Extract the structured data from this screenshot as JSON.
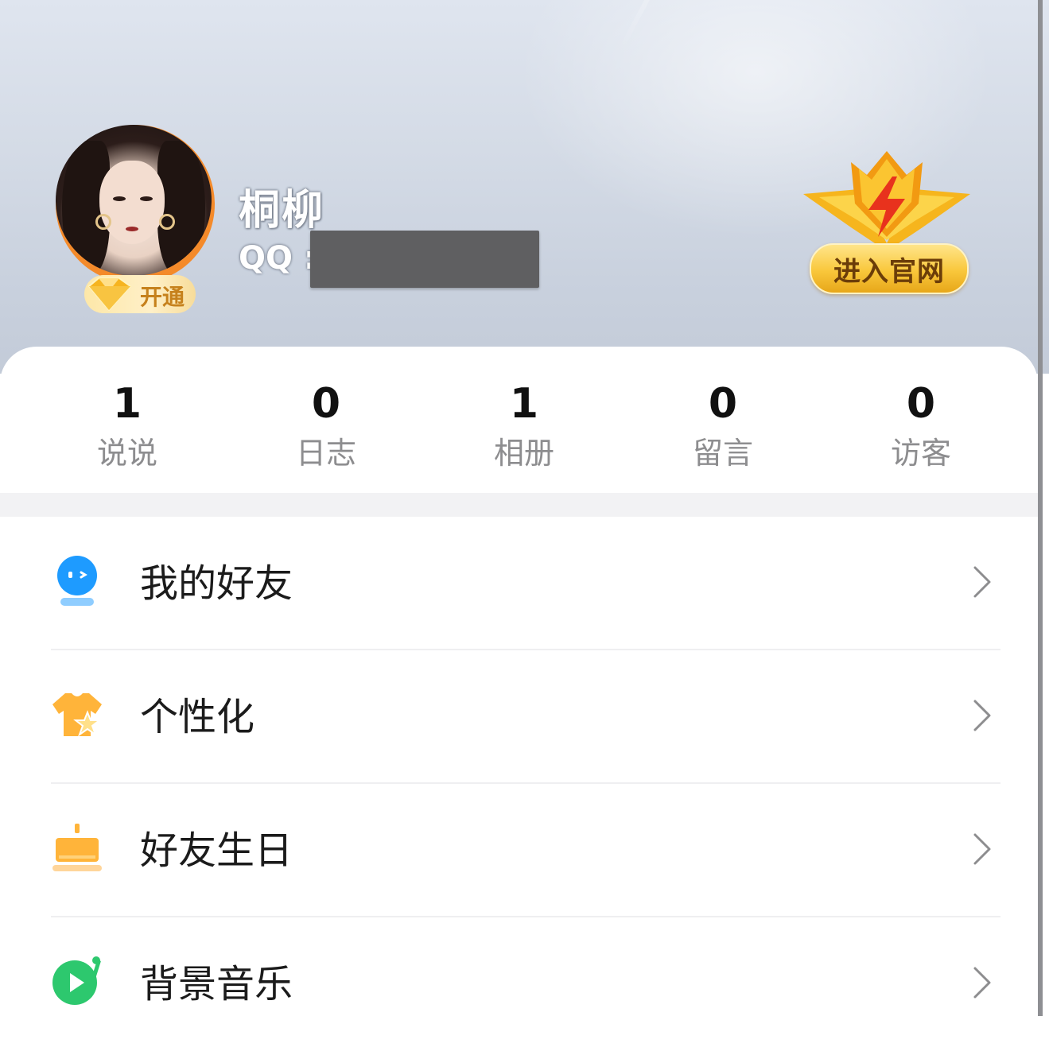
{
  "profile": {
    "name": "桐柳",
    "qq_label": "QQ :",
    "vip_badge_label": "开通",
    "official_button_label": "进入官网"
  },
  "stats": [
    {
      "value": "1",
      "label": "说说"
    },
    {
      "value": "0",
      "label": "日志"
    },
    {
      "value": "1",
      "label": "相册"
    },
    {
      "value": "0",
      "label": "留言"
    },
    {
      "value": "0",
      "label": "访客"
    }
  ],
  "menu": [
    {
      "label": "我的好友",
      "icon": "friends-icon",
      "color": "#1e9bff"
    },
    {
      "label": "个性化",
      "icon": "tshirt-star-icon",
      "color": "#ffb43a"
    },
    {
      "label": "好友生日",
      "icon": "birthday-cake-icon",
      "color": "#ffb43a"
    },
    {
      "label": "背景音乐",
      "icon": "music-play-icon",
      "color": "#2dc86e"
    }
  ],
  "colors": {
    "avatar_ring": "#f48a2a",
    "badge_gold": "#f9c73b",
    "muted_text": "#8d8d8f"
  }
}
